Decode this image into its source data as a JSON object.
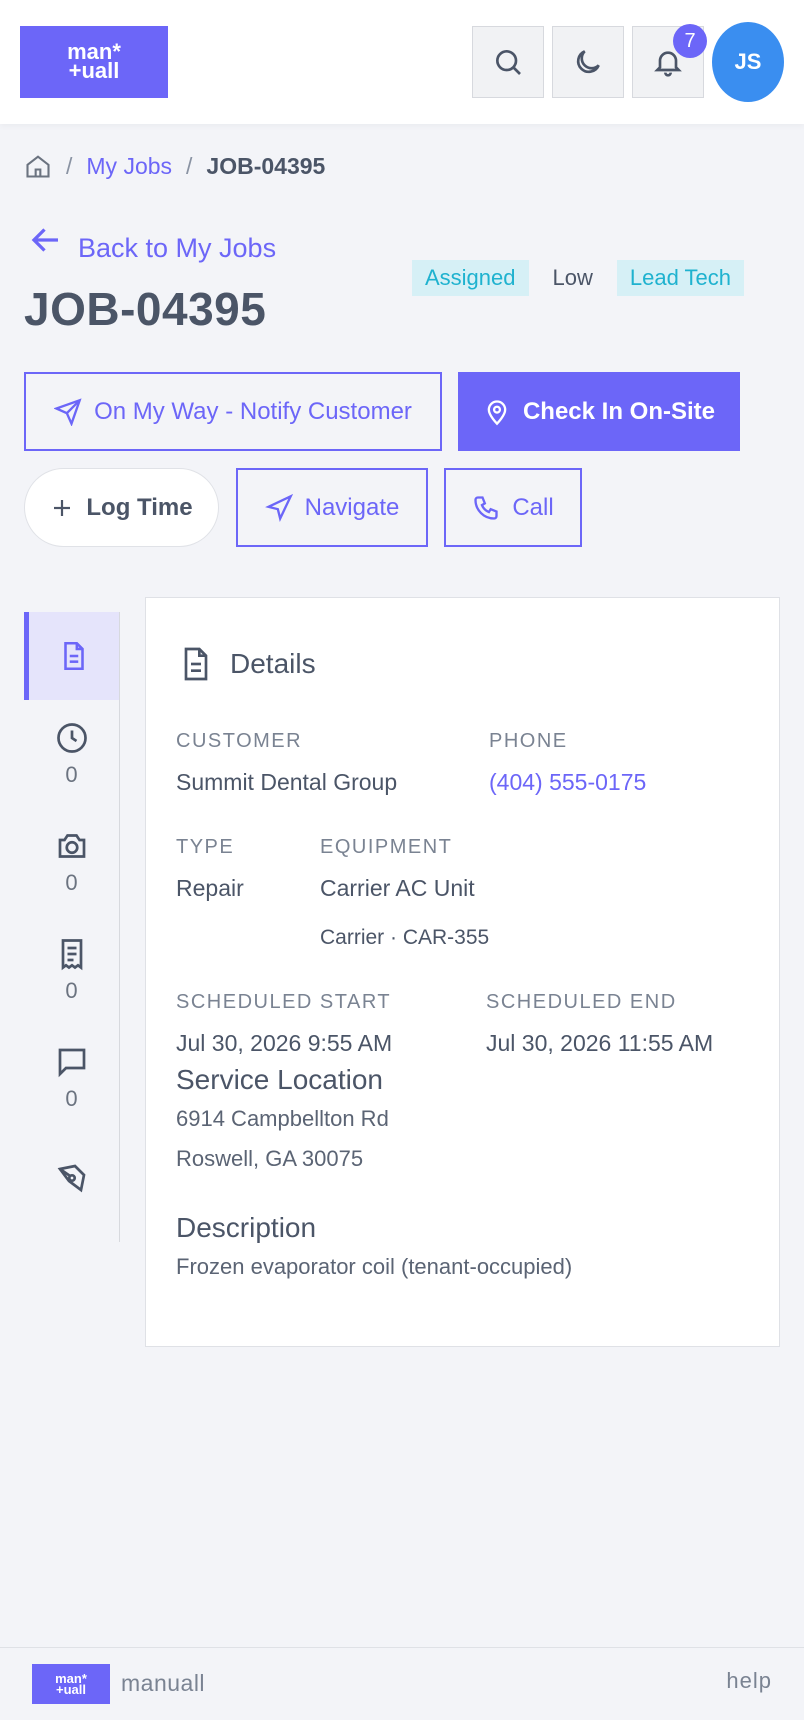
{
  "app": {
    "logo_line1": "man*",
    "logo_line2": "+uall",
    "notification_count": "7",
    "user_initials": "JS",
    "colors": {
      "accent": "#6c66f8",
      "avatar": "#3a8ef0",
      "tag_text": "#1fb2cf",
      "tag_bg": "#d6f0f6"
    }
  },
  "header_icons": [
    "search-icon",
    "moon-icon",
    "bell-icon"
  ],
  "breadcrumb": {
    "home_icon": "home-icon",
    "sep": "/",
    "link": "My Jobs",
    "current": "JOB-04395"
  },
  "back": {
    "label": "Back to My Jobs"
  },
  "job": {
    "title": "JOB-04395",
    "status": "Assigned",
    "priority": "Low",
    "role": "Lead Tech"
  },
  "actions": {
    "on_my_way": "On My Way - Notify Customer",
    "check_in": "Check In On-Site",
    "log_time": "Log Time",
    "navigate": "Navigate",
    "call": "Call"
  },
  "rail": [
    {
      "icon": "document-icon",
      "count": ""
    },
    {
      "icon": "clock-icon",
      "count": "0"
    },
    {
      "icon": "camera-icon",
      "count": "0"
    },
    {
      "icon": "receipt-icon",
      "count": "0"
    },
    {
      "icon": "chat-icon",
      "count": "0"
    },
    {
      "icon": "pen-icon",
      "count": ""
    }
  ],
  "details": {
    "title": "Details",
    "customer_label": "CUSTOMER",
    "customer": "Summit Dental Group",
    "phone_label": "PHONE",
    "phone": "(404) 555-0175",
    "type_label": "TYPE",
    "type": "Repair",
    "equipment_label": "EQUIPMENT",
    "equipment": "Carrier AC Unit",
    "equipment_sub": "Carrier · CAR-355",
    "start_label": "SCHEDULED START",
    "start": "Jul 30, 2026 9:55 AM",
    "end_label": "SCHEDULED END",
    "end": "Jul 30, 2026 11:55 AM",
    "location_title": "Service Location",
    "address1": "6914 Campbellton Rd",
    "address2": "Roswell, GA 30075",
    "description_title": "Description",
    "description": "Frozen evaporator coil (tenant-occupied)"
  },
  "footer": {
    "logo_line1": "man*",
    "logo_line2": "+uall",
    "name": "manuall",
    "help": "help"
  }
}
